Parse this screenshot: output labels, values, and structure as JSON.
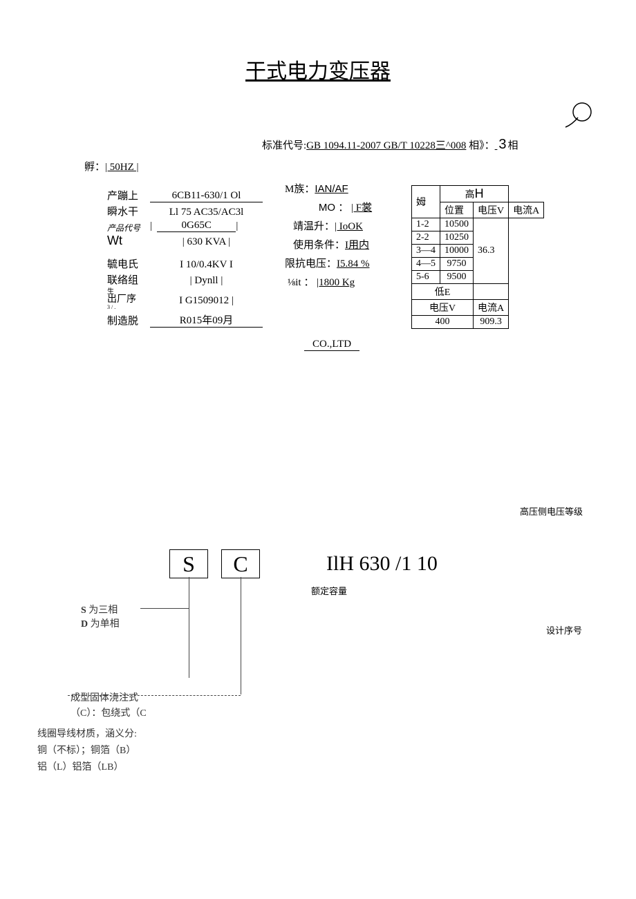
{
  "title": "干式电力变压器",
  "standard": {
    "label": "标准代号:",
    "code": "GB 1094.11-2007 GB/T 10228三^008",
    "phase_label": "相》：",
    "phase_blank": "          ",
    "phase_num": "3",
    "phase_suffix": "相"
  },
  "freq": {
    "label": "孵：",
    "value": "| 50HZ |"
  },
  "left_specs": [
    {
      "label": "产蹦上",
      "value": "6CB11-630/1 Ol"
    },
    {
      "label": "瞬水干",
      "value": "Ll 75 AC35/AC3l"
    },
    {
      "label_small": "产品代号",
      "value": "0G65C",
      "prefix": "|"
    },
    {
      "label_wt": "Wt",
      "value": "| 630 KVA |"
    },
    {
      "spacer": true
    },
    {
      "label": "毓电氏",
      "value": "I 10/0.4KV I"
    },
    {
      "label": "联络组",
      "value": "| Dynll |"
    },
    {
      "label_small": "出厂序",
      "tiny": "3 / .",
      "value": "I G1509012 |"
    },
    {
      "label": "制造脱",
      "value": "R015年09月"
    }
  ],
  "mid_specs": [
    {
      "text": "M族：",
      "value": "IAN/AF",
      "u": true,
      "arial": true
    },
    {
      "text": "MO ：",
      "value": "| F裳",
      "indent": "   ",
      "arial": true
    },
    {
      "text": "靖温升：",
      "value": "| IoOK"
    },
    {
      "text": "使用条件：",
      "value": "I用内"
    },
    {
      "text": "限抗电压：",
      "value": "I5.84 %"
    },
    {
      "text": "⅛it ：",
      "value": "|1800 Kg"
    }
  ],
  "co": "CO.,LTD",
  "table": {
    "r1c1": "姆",
    "r1c2": "高",
    "r1c2b": "H",
    "r2c1": "位置",
    "r2c2": "电压V",
    "r2c3": "电流A",
    "taps": [
      {
        "pos": "1-2",
        "v": "10500"
      },
      {
        "pos": "2-2",
        "v": "10250"
      },
      {
        "pos": "3—4",
        "v": "10000"
      },
      {
        "pos": "4—5",
        "v": "9750"
      },
      {
        "pos": "5-6",
        "v": "9500"
      }
    ],
    "hv_current": "36.3",
    "low_label": "低E",
    "lv_v_label": "电压V",
    "lv_a_label": "电流A",
    "lv_v": "400",
    "lv_a": "909.3"
  },
  "diagram": {
    "boxS": "S",
    "boxC": "C",
    "s_line1": "S 为三相",
    "s_line2": "D 为单相",
    "s_bold_s": "S",
    "s_bold_d": "D",
    "mold_line1": "成型固体浇注式",
    "mold_line2": "（C）：包绕式（C",
    "wire_line1": "线圈导线材质，涵义分:",
    "wire_line2": "铜（不标）；铜箔（B）",
    "wire_line3": "铝（L）铝箔（LB）",
    "ilh": "IlH 630 /1 10",
    "rated": "额定容量",
    "hvclass": "高压侧电压等级",
    "designno": "设计序号"
  }
}
